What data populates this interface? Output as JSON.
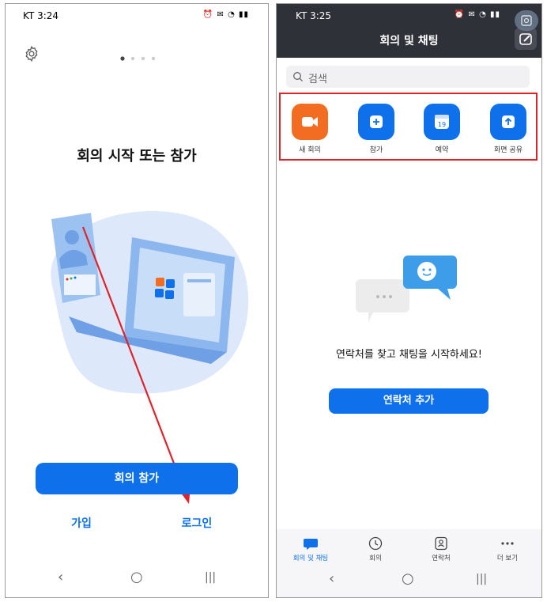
{
  "left": {
    "status_time": "KT 3:24",
    "title": "회의 시작 또는 참가",
    "join_meeting_label": "회의 참가",
    "signup_label": "가입",
    "login_label": "로그인"
  },
  "right": {
    "status_time": "KT 3:25",
    "header_title": "회의 및 채팅",
    "search_placeholder": "검색",
    "actions": [
      {
        "label": "새 회의",
        "icon": "video-camera-icon"
      },
      {
        "label": "참가",
        "icon": "plus-icon"
      },
      {
        "label": "예약",
        "icon": "calendar-icon"
      },
      {
        "label": "화면 공유",
        "icon": "share-screen-icon"
      }
    ],
    "calendar_day": "19",
    "empty_message": "연락처를 찾고 채팅을 시작하세요!",
    "add_contact_label": "연락처 추가",
    "tabs": [
      {
        "label": "회의 및 채팅",
        "icon": "chat-icon",
        "active": true
      },
      {
        "label": "회의",
        "icon": "clock-icon",
        "active": false
      },
      {
        "label": "연락처",
        "icon": "contacts-icon",
        "active": false
      },
      {
        "label": "더 보기",
        "icon": "more-icon",
        "active": false
      }
    ]
  },
  "colors": {
    "accent": "#0e71eb",
    "orange": "#f26d21",
    "header_bg": "#2e3138",
    "annotation_red": "#e0232b"
  }
}
